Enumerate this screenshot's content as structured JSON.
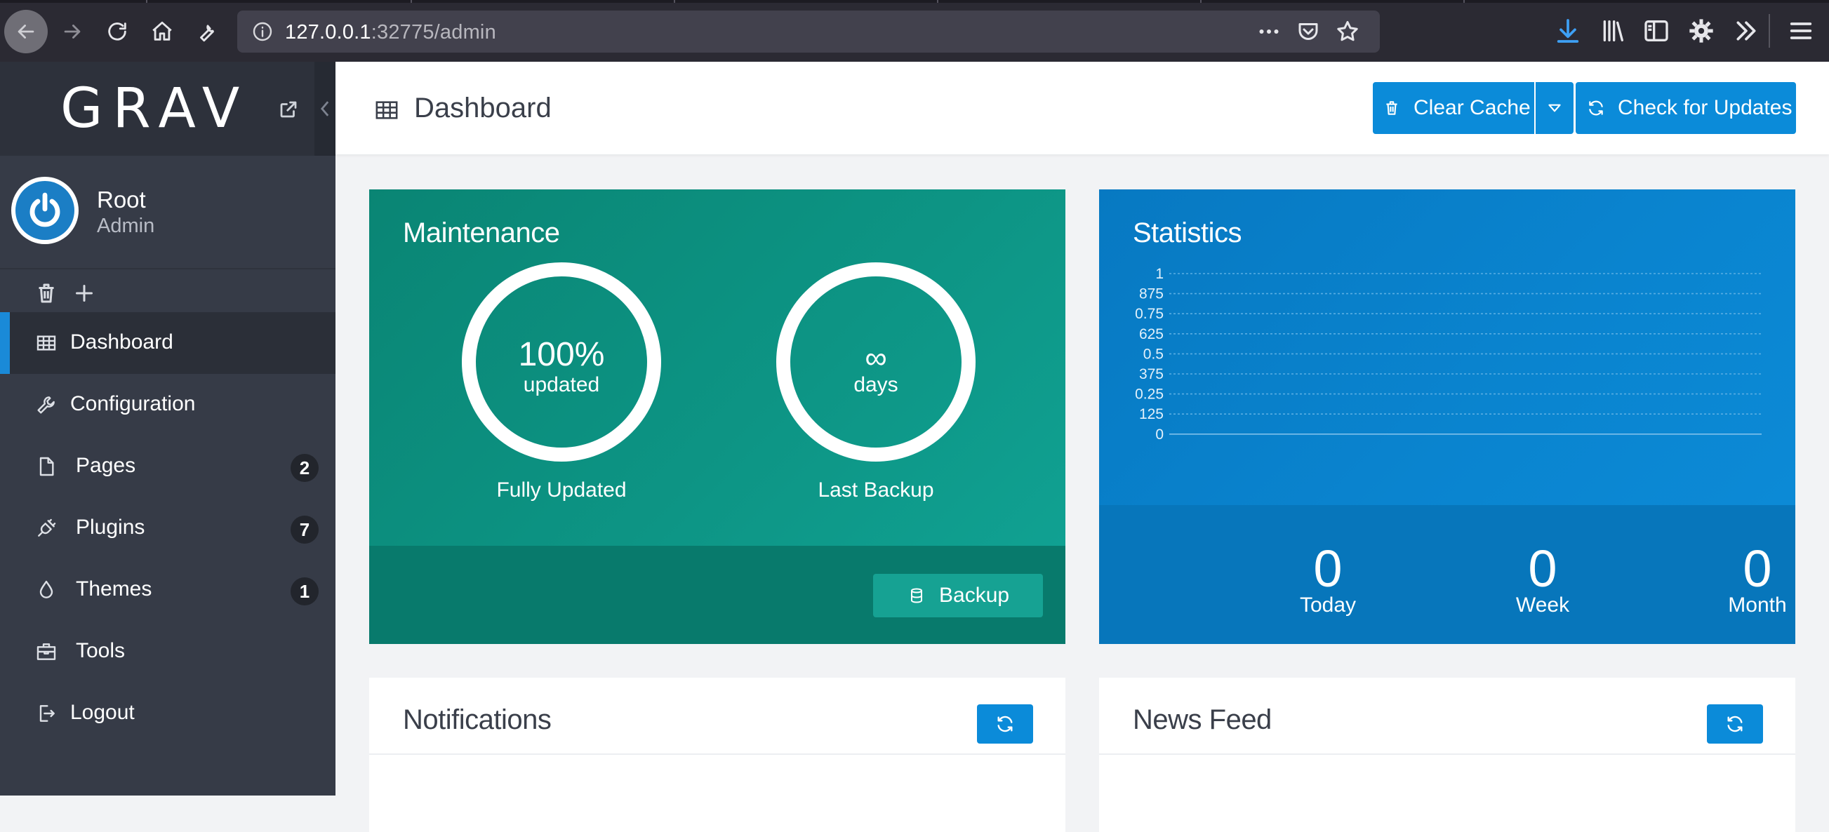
{
  "browser": {
    "url_host": "127.0.0.1",
    "url_rest": ":32775/admin"
  },
  "sidebar": {
    "logo": "GRAV",
    "user": {
      "name": "Root",
      "role": "Admin"
    },
    "items": [
      {
        "label": "Dashboard",
        "icon": "grid-icon",
        "active": true
      },
      {
        "label": "Configuration",
        "icon": "wrench-icon"
      },
      {
        "label": "Pages",
        "icon": "file-icon",
        "badge": "2"
      },
      {
        "label": "Plugins",
        "icon": "plug-icon",
        "badge": "7"
      },
      {
        "label": "Themes",
        "icon": "droplet-icon",
        "badge": "1"
      },
      {
        "label": "Tools",
        "icon": "briefcase-icon"
      },
      {
        "label": "Logout",
        "icon": "sign-out-icon"
      }
    ]
  },
  "header": {
    "title": "Dashboard",
    "clear_cache": "Clear Cache",
    "check_updates": "Check for Updates"
  },
  "maintenance": {
    "title": "Maintenance",
    "updated_value": "100%",
    "updated_unit": "updated",
    "updated_caption": "Fully Updated",
    "backup_value": "∞",
    "backup_unit": "days",
    "backup_caption": "Last Backup",
    "backup_button": "Backup"
  },
  "statistics": {
    "title": "Statistics",
    "y_ticks": [
      "1",
      "875",
      "0.75",
      "625",
      "0.5",
      "375",
      "0.25",
      "125",
      "0"
    ],
    "today": "0",
    "today_label": "Today",
    "week": "0",
    "week_label": "Week",
    "month": "0",
    "month_label": "Month"
  },
  "notifications": {
    "title": "Notifications"
  },
  "news_feed": {
    "title": "News Feed"
  },
  "colors": {
    "sidebar_bg": "#363b47",
    "accent_blue": "#0b8bd9",
    "maintenance_green": "#0a8d7e",
    "statistics_blue": "#0a82ca"
  }
}
